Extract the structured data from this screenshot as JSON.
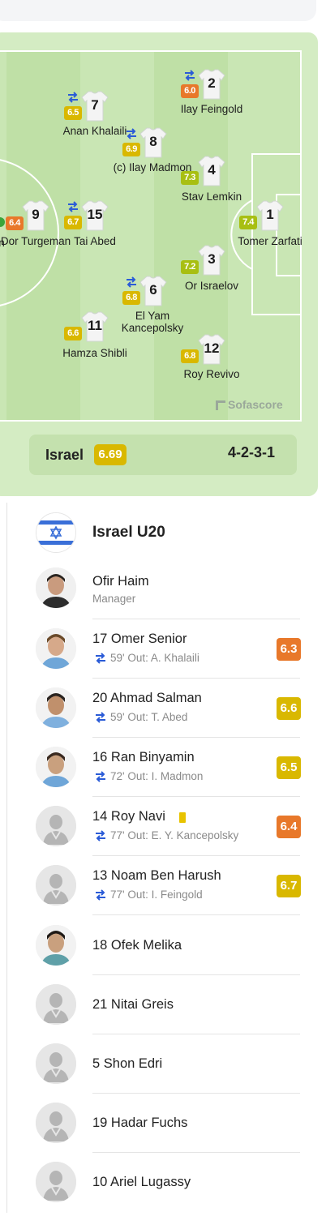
{
  "colors": {
    "rating_orange": "#e8782a",
    "rating_yellow": "#d9b800",
    "rating_green": "#a8bf12",
    "sub_blue": "#2a5bd7",
    "yellow_card": "#e8c300"
  },
  "watermark": "Sofascore",
  "lineup": {
    "team": "Israel",
    "team_rating": "6.69",
    "formation": "4-2-3-1",
    "cut_off_player_rating": "6.4",
    "cut_off_player_name_fragment": "n",
    "players": [
      {
        "number": "2",
        "name": "Ilay Feingold",
        "rating": "6.0",
        "rating_level": "orange",
        "subbed": true
      },
      {
        "number": "7",
        "name": "Anan Khalaili",
        "rating": "6.5",
        "rating_level": "yellow",
        "subbed": true
      },
      {
        "number": "8",
        "name": "(c) Ilay Madmon",
        "rating": "6.9",
        "rating_level": "yellow",
        "subbed": true
      },
      {
        "number": "4",
        "name": "Stav Lemkin",
        "rating": "7.3",
        "rating_level": "green",
        "subbed": false
      },
      {
        "number": "9",
        "name": "Dor Turgeman",
        "rating": "",
        "rating_level": "",
        "subbed": false
      },
      {
        "number": "15",
        "name": "Tai Abed",
        "rating": "6.7",
        "rating_level": "yellow",
        "subbed": true
      },
      {
        "number": "1",
        "name": "Tomer Zarfati",
        "rating": "7.4",
        "rating_level": "green",
        "subbed": false
      },
      {
        "number": "3",
        "name": "Or Israelov",
        "rating": "7.2",
        "rating_level": "green",
        "subbed": false
      },
      {
        "number": "6",
        "name": "El Yam Kancepolsky",
        "rating": "6.8",
        "rating_level": "yellow",
        "subbed": true
      },
      {
        "number": "11",
        "name": "Hamza Shibli",
        "rating": "6.6",
        "rating_level": "yellow",
        "subbed": false
      },
      {
        "number": "12",
        "name": "Roy Revivo",
        "rating": "6.8",
        "rating_level": "yellow",
        "subbed": false
      }
    ]
  },
  "bench": {
    "team_name": "Israel U20",
    "flag_icon": "israel-flag-icon",
    "manager": {
      "name": "Ofir Haim",
      "role": "Manager"
    },
    "subs": [
      {
        "label": "17 Omer Senior",
        "minute": "59'",
        "out_label": "Out:",
        "out_player": "A. Khalaili",
        "rating": "6.3",
        "rating_level": "orange",
        "yellow_card": false
      },
      {
        "label": "20 Ahmad Salman",
        "minute": "59'",
        "out_label": "Out:",
        "out_player": "T. Abed",
        "rating": "6.6",
        "rating_level": "yellow",
        "yellow_card": false
      },
      {
        "label": "16 Ran Binyamin",
        "minute": "72'",
        "out_label": "Out:",
        "out_player": "I. Madmon",
        "rating": "6.5",
        "rating_level": "yellow",
        "yellow_card": false
      },
      {
        "label": "14 Roy Navi",
        "minute": "77'",
        "out_label": "Out:",
        "out_player": "E. Y. Kancepolsky",
        "rating": "6.4",
        "rating_level": "orange",
        "yellow_card": true
      },
      {
        "label": "13 Noam Ben Harush",
        "minute": "77'",
        "out_label": "Out:",
        "out_player": "I. Feingold",
        "rating": "6.7",
        "rating_level": "yellow",
        "yellow_card": false
      }
    ],
    "unused": [
      {
        "label": "18 Ofek Melika"
      },
      {
        "label": "21 Nitai Greis"
      },
      {
        "label": "5 Shon Edri"
      },
      {
        "label": "19 Hadar Fuchs"
      },
      {
        "label": "10 Ariel Lugassy"
      }
    ]
  }
}
